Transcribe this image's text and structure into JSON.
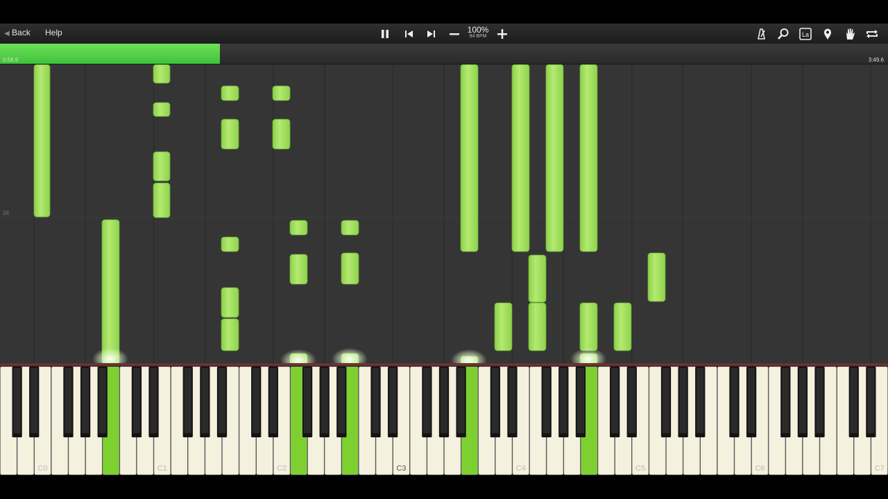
{
  "toolbar": {
    "back_label": "Back",
    "help_label": "Help",
    "zoom_label": "100%",
    "bpm_label": "94 BPM",
    "icons": [
      "pause-icon",
      "skip-back-icon",
      "skip-forward-icon",
      "minus-icon",
      "plus-icon",
      "metronome-icon",
      "search-icon",
      "label-icon",
      "location-pin-icon",
      "hand-icon",
      "loop-icon"
    ],
    "label_icon_text": "La"
  },
  "progress": {
    "current_time": "0:56.9",
    "total_time": "3:49.6",
    "fraction": 0.248,
    "fill_color": "#3fc23a"
  },
  "roll": {
    "measure_label": "24",
    "note_color": "#a8e063",
    "background": "#353535"
  },
  "keyboard": {
    "octave_labels": [
      "C0",
      "C1",
      "C2",
      "C3",
      "C4",
      "C5",
      "C6",
      "C7"
    ],
    "highlight_color": "#7ed030",
    "pressed_keys": [
      6,
      17,
      20,
      27,
      34
    ]
  }
}
